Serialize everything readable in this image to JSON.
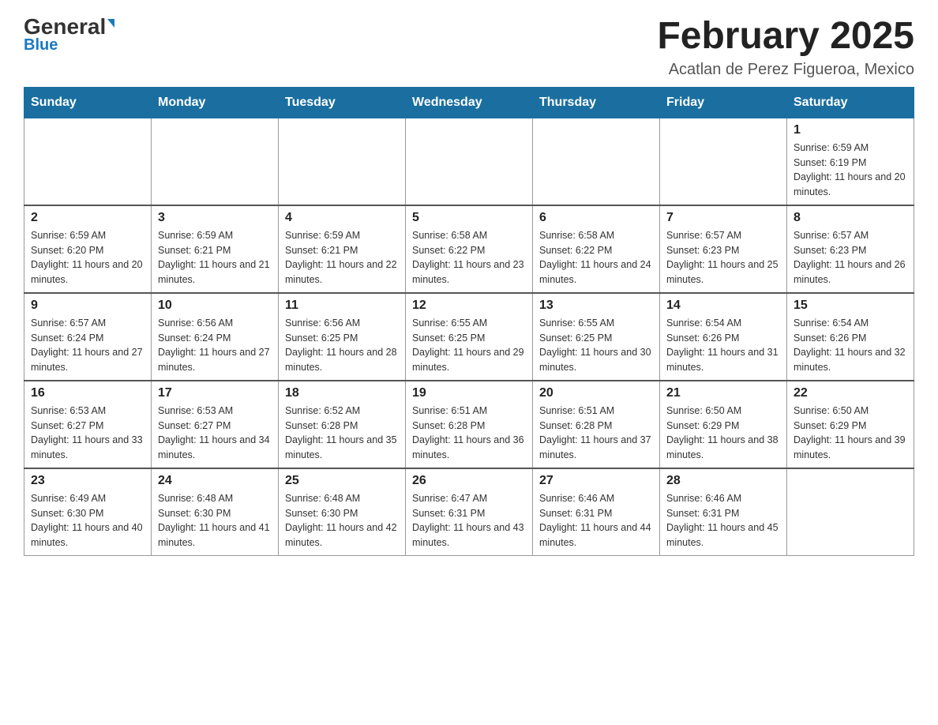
{
  "header": {
    "logo_general": "General",
    "logo_blue": "Blue",
    "month_year": "February 2025",
    "location": "Acatlan de Perez Figueroa, Mexico"
  },
  "days_of_week": [
    "Sunday",
    "Monday",
    "Tuesday",
    "Wednesday",
    "Thursday",
    "Friday",
    "Saturday"
  ],
  "weeks": [
    [
      {
        "day": "",
        "info": ""
      },
      {
        "day": "",
        "info": ""
      },
      {
        "day": "",
        "info": ""
      },
      {
        "day": "",
        "info": ""
      },
      {
        "day": "",
        "info": ""
      },
      {
        "day": "",
        "info": ""
      },
      {
        "day": "1",
        "info": "Sunrise: 6:59 AM\nSunset: 6:19 PM\nDaylight: 11 hours and 20 minutes."
      }
    ],
    [
      {
        "day": "2",
        "info": "Sunrise: 6:59 AM\nSunset: 6:20 PM\nDaylight: 11 hours and 20 minutes."
      },
      {
        "day": "3",
        "info": "Sunrise: 6:59 AM\nSunset: 6:21 PM\nDaylight: 11 hours and 21 minutes."
      },
      {
        "day": "4",
        "info": "Sunrise: 6:59 AM\nSunset: 6:21 PM\nDaylight: 11 hours and 22 minutes."
      },
      {
        "day": "5",
        "info": "Sunrise: 6:58 AM\nSunset: 6:22 PM\nDaylight: 11 hours and 23 minutes."
      },
      {
        "day": "6",
        "info": "Sunrise: 6:58 AM\nSunset: 6:22 PM\nDaylight: 11 hours and 24 minutes."
      },
      {
        "day": "7",
        "info": "Sunrise: 6:57 AM\nSunset: 6:23 PM\nDaylight: 11 hours and 25 minutes."
      },
      {
        "day": "8",
        "info": "Sunrise: 6:57 AM\nSunset: 6:23 PM\nDaylight: 11 hours and 26 minutes."
      }
    ],
    [
      {
        "day": "9",
        "info": "Sunrise: 6:57 AM\nSunset: 6:24 PM\nDaylight: 11 hours and 27 minutes."
      },
      {
        "day": "10",
        "info": "Sunrise: 6:56 AM\nSunset: 6:24 PM\nDaylight: 11 hours and 27 minutes."
      },
      {
        "day": "11",
        "info": "Sunrise: 6:56 AM\nSunset: 6:25 PM\nDaylight: 11 hours and 28 minutes."
      },
      {
        "day": "12",
        "info": "Sunrise: 6:55 AM\nSunset: 6:25 PM\nDaylight: 11 hours and 29 minutes."
      },
      {
        "day": "13",
        "info": "Sunrise: 6:55 AM\nSunset: 6:25 PM\nDaylight: 11 hours and 30 minutes."
      },
      {
        "day": "14",
        "info": "Sunrise: 6:54 AM\nSunset: 6:26 PM\nDaylight: 11 hours and 31 minutes."
      },
      {
        "day": "15",
        "info": "Sunrise: 6:54 AM\nSunset: 6:26 PM\nDaylight: 11 hours and 32 minutes."
      }
    ],
    [
      {
        "day": "16",
        "info": "Sunrise: 6:53 AM\nSunset: 6:27 PM\nDaylight: 11 hours and 33 minutes."
      },
      {
        "day": "17",
        "info": "Sunrise: 6:53 AM\nSunset: 6:27 PM\nDaylight: 11 hours and 34 minutes."
      },
      {
        "day": "18",
        "info": "Sunrise: 6:52 AM\nSunset: 6:28 PM\nDaylight: 11 hours and 35 minutes."
      },
      {
        "day": "19",
        "info": "Sunrise: 6:51 AM\nSunset: 6:28 PM\nDaylight: 11 hours and 36 minutes."
      },
      {
        "day": "20",
        "info": "Sunrise: 6:51 AM\nSunset: 6:28 PM\nDaylight: 11 hours and 37 minutes."
      },
      {
        "day": "21",
        "info": "Sunrise: 6:50 AM\nSunset: 6:29 PM\nDaylight: 11 hours and 38 minutes."
      },
      {
        "day": "22",
        "info": "Sunrise: 6:50 AM\nSunset: 6:29 PM\nDaylight: 11 hours and 39 minutes."
      }
    ],
    [
      {
        "day": "23",
        "info": "Sunrise: 6:49 AM\nSunset: 6:30 PM\nDaylight: 11 hours and 40 minutes."
      },
      {
        "day": "24",
        "info": "Sunrise: 6:48 AM\nSunset: 6:30 PM\nDaylight: 11 hours and 41 minutes."
      },
      {
        "day": "25",
        "info": "Sunrise: 6:48 AM\nSunset: 6:30 PM\nDaylight: 11 hours and 42 minutes."
      },
      {
        "day": "26",
        "info": "Sunrise: 6:47 AM\nSunset: 6:31 PM\nDaylight: 11 hours and 43 minutes."
      },
      {
        "day": "27",
        "info": "Sunrise: 6:46 AM\nSunset: 6:31 PM\nDaylight: 11 hours and 44 minutes."
      },
      {
        "day": "28",
        "info": "Sunrise: 6:46 AM\nSunset: 6:31 PM\nDaylight: 11 hours and 45 minutes."
      },
      {
        "day": "",
        "info": ""
      }
    ]
  ]
}
